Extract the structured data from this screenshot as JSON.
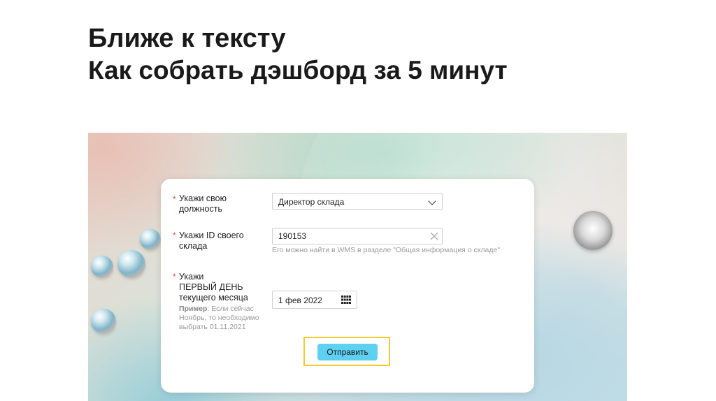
{
  "slide": {
    "title": "Ближе к тексту",
    "subtitle": "Как собрать дэшборд за 5 минут"
  },
  "form": {
    "position_field": {
      "required_mark": "*",
      "label_line1": "Укажи свою",
      "label_line2": "должность",
      "value": "Директор склада",
      "icon": "chevron-down-icon"
    },
    "warehouse_id_field": {
      "required_mark": "*",
      "label_line1": "Укажи ID своего",
      "label_line2": "склада",
      "value": "190153",
      "hint": "Его можно найти в WMS в разделе \"Общая информация о складе\"",
      "icon": "clear-icon"
    },
    "first_day_field": {
      "required_mark": "*",
      "label_line1": "Укажи",
      "label_line2": "ПЕРВЫЙ ДЕНЬ",
      "label_line3": "текущего месяца",
      "example_label": "Пример",
      "example_line1": ": Если сейчас",
      "example_line2": "Ноябрь, то необходимо",
      "example_line3": "выбрать 01.11.2021",
      "value": "1 фев 2022",
      "icon": "calendar-icon"
    },
    "submit_label": "Отправить"
  },
  "colors": {
    "required": "#e04848",
    "button": "#5ed0f2",
    "highlight": "#f2cc2a",
    "hint": "#9a9a9a"
  }
}
